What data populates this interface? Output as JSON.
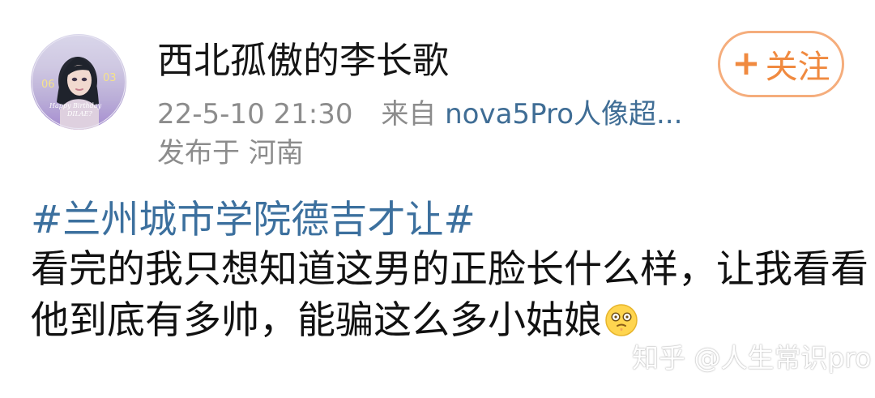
{
  "post": {
    "author": {
      "name": "西北孤傲的李长歌",
      "avatar_text_left": "06",
      "avatar_text_right": "03",
      "avatar_caption_line1": "Happy Birthday",
      "avatar_caption_line2": "DILAE?"
    },
    "meta": {
      "timestamp": "22-5-10 21:30",
      "source_prefix": "来自",
      "source_link": "nova5Pro人像超...",
      "location": "发布于 河南"
    },
    "follow_button": {
      "icon": "plus-icon",
      "label": "关注"
    },
    "content": {
      "hashtag": "#兰州城市学院德吉才让#",
      "line_1": "看完的我只想知道这男的正脸长什么样，让我看看",
      "line_2": "他到底有多帅，能骗这么多小姑娘",
      "emoji": "speechless-face-emoji"
    },
    "watermark": "知乎 @人生常识pro"
  },
  "colors": {
    "username": "#151515",
    "meta": "#8c8c8c",
    "link": "#3f6d95",
    "hashtag": "#3c709e",
    "follow_accent": "#f08a40",
    "follow_border": "#f5ad7c"
  }
}
